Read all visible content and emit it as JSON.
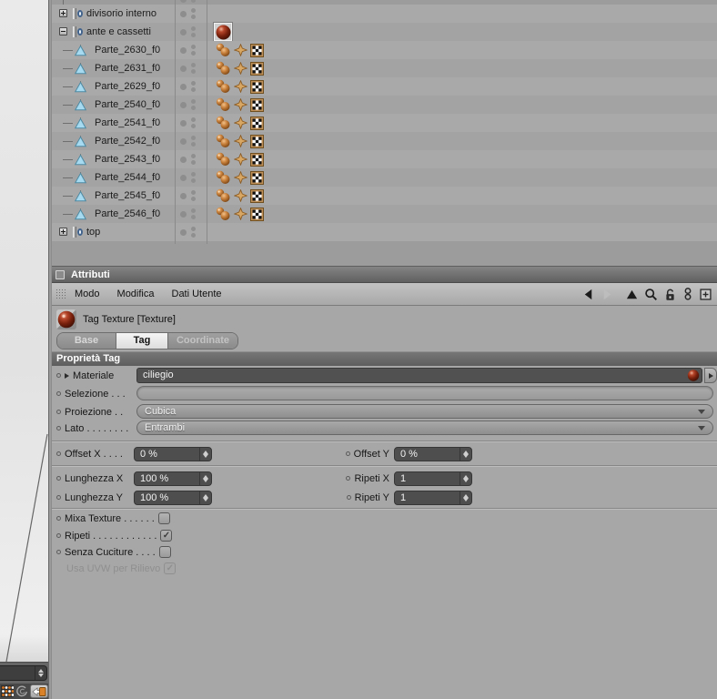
{
  "object_manager": {
    "rows": [
      {
        "label": "divisorio interno",
        "type": "group",
        "expander": "plus",
        "tags": []
      },
      {
        "label": "ante e cassetti",
        "type": "group",
        "expander": "minus",
        "tags": [
          "material-ciliegio"
        ]
      },
      {
        "label": "Parte_2630_f0",
        "type": "polygon",
        "tags": [
          "phong",
          "uvw",
          "texture-checker"
        ]
      },
      {
        "label": "Parte_2631_f0",
        "type": "polygon",
        "tags": [
          "phong",
          "uvw",
          "texture-checker"
        ]
      },
      {
        "label": "Parte_2629_f0",
        "type": "polygon",
        "tags": [
          "phong",
          "uvw",
          "texture-checker"
        ]
      },
      {
        "label": "Parte_2540_f0",
        "type": "polygon",
        "tags": [
          "phong",
          "uvw",
          "texture-checker"
        ]
      },
      {
        "label": "Parte_2541_f0",
        "type": "polygon",
        "tags": [
          "phong",
          "uvw",
          "texture-checker"
        ]
      },
      {
        "label": "Parte_2542_f0",
        "type": "polygon",
        "tags": [
          "phong",
          "uvw",
          "texture-checker"
        ]
      },
      {
        "label": "Parte_2543_f0",
        "type": "polygon",
        "tags": [
          "phong",
          "uvw",
          "texture-checker"
        ]
      },
      {
        "label": "Parte_2544_f0",
        "type": "polygon",
        "tags": [
          "phong",
          "uvw",
          "texture-checker"
        ]
      },
      {
        "label": "Parte_2545_f0",
        "type": "polygon",
        "tags": [
          "phong",
          "uvw",
          "texture-checker"
        ]
      },
      {
        "label": "Parte_2546_f0",
        "type": "polygon",
        "tags": [
          "phong",
          "uvw",
          "texture-checker"
        ]
      },
      {
        "label": "top",
        "type": "group",
        "expander": "plus",
        "tags": []
      }
    ]
  },
  "attributes_panel": {
    "title": "Attributi",
    "menu_items": [
      {
        "label": "Modo"
      },
      {
        "label": "Modifica"
      },
      {
        "label": "Dati Utente"
      }
    ],
    "toolbar_icons": [
      "back",
      "forward",
      "up",
      "search",
      "lock-open",
      "link-circles",
      "add-panel"
    ],
    "object_header": {
      "label": "Tag Texture [Texture]",
      "icon": "texture-ball"
    },
    "tabs": [
      {
        "label": "Base",
        "active": false
      },
      {
        "label": "Tag",
        "active": true
      },
      {
        "label": "Coordinate",
        "active": false
      }
    ],
    "section_title": "Proprietà Tag",
    "fields": {
      "materiale": {
        "label": "Materiale",
        "value": "ciliegio"
      },
      "selezione": {
        "label": "Selezione . . .",
        "value": ""
      },
      "proiezione": {
        "label": "Proiezione . .",
        "value": "Cubica"
      },
      "lato": {
        "label": "Lato . . . . . . . .",
        "value": "Entrambi"
      },
      "offset_x": {
        "label": "Offset X . . . .",
        "value": "0 %"
      },
      "offset_y": {
        "label": "Offset Y",
        "value": "0 %"
      },
      "lunghezza_x": {
        "label": "Lunghezza X",
        "value": "100 %"
      },
      "ripeti_x": {
        "label": "Ripeti X",
        "value": "1"
      },
      "lunghezza_y": {
        "label": "Lunghezza Y",
        "value": "100 %"
      },
      "ripeti_y": {
        "label": "Ripeti Y",
        "value": "1"
      },
      "mixa_texture": {
        "label": "Mixa Texture . . . . . .",
        "checked": false,
        "glyph": ""
      },
      "ripeti": {
        "label": "Ripeti . . . . . . . . . . . .",
        "checked": true,
        "glyph": "✓"
      },
      "senza_cuciture": {
        "label": "Senza Cuciture . . . .",
        "checked": false,
        "glyph": ""
      },
      "usa_uvw": {
        "label": "Usa UVW per Rilievo",
        "checked": true,
        "disabled": true,
        "glyph": "✓"
      }
    }
  },
  "colors": {
    "panel_bg": "#a7a7a7",
    "row_stripe_a": "#a9a9a9",
    "row_stripe_b": "#a3a3a3",
    "dark_field": "#515151",
    "section_bar": "#666666",
    "material_ball": "#7a241022",
    "accent_orange": "#d9822a"
  }
}
